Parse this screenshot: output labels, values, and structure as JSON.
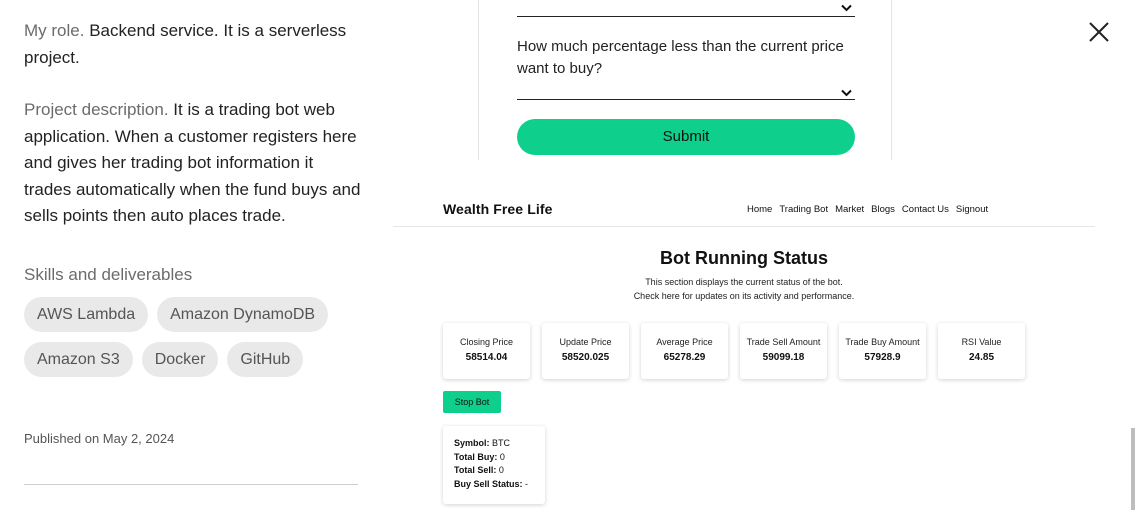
{
  "sidebar": {
    "role_lead": "My role.",
    "role_text": " Backend service. It is a serverless project.",
    "desc_lead": "Project description.",
    "desc_text": " It is a trading bot web application. When a customer registers here and gives her trading bot information it trades automatically when the fund buys and sells points then auto places trade.",
    "skills_title": "Skills and deliverables",
    "skills": [
      "AWS Lambda",
      "Amazon DynamoDB",
      "Amazon S3",
      "Docker",
      "GitHub"
    ],
    "published": "Published on May 2, 2024"
  },
  "form": {
    "question": "How much percentage less than the current price want to buy?",
    "submit_label": "Submit"
  },
  "app": {
    "brand": "Wealth Free Life",
    "nav": [
      "Home",
      "Trading Bot",
      "Market",
      "Blogs",
      "Contact Us",
      "Signout"
    ],
    "title": "Bot Running Status",
    "subtitle_1": "This section displays the current status of the bot.",
    "subtitle_2": "Check here for updates on its activity and performance.",
    "metrics": [
      {
        "label": "Closing Price",
        "value": "58514.04"
      },
      {
        "label": "Update Price",
        "value": "58520.025"
      },
      {
        "label": "Average Price",
        "value": "65278.29"
      },
      {
        "label": "Trade Sell Amount",
        "value": "59099.18"
      },
      {
        "label": "Trade Buy Amount",
        "value": "57928.9"
      },
      {
        "label": "RSI Value",
        "value": "24.85"
      }
    ],
    "stop_label": "Stop Bot",
    "info": {
      "symbol_label": "Symbol:",
      "symbol_value": " BTC",
      "total_buy_label": "Total Buy:",
      "total_buy_value": " 0",
      "total_sell_label": "Total Sell:",
      "total_sell_value": " 0",
      "status_label": "Buy Sell Status:",
      "status_value": " -"
    }
  },
  "colors": {
    "accent": "#0ecf8c",
    "chip_bg": "#e9e9e9",
    "muted": "#6b6b6b"
  },
  "icons": {
    "close": "close-icon",
    "chevron": "chevron-down-icon"
  }
}
